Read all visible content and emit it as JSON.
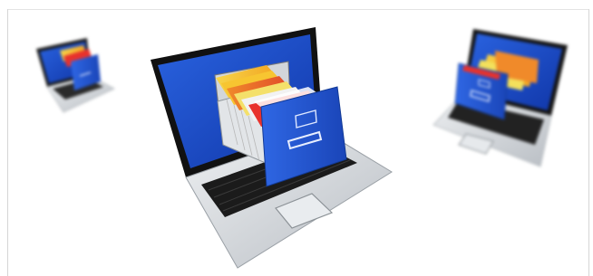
{
  "image": {
    "title_text_partial": "",
    "accent_colors": {
      "screen_blue": "#1f4fc9",
      "drawer_blue": "#2559d6",
      "laptop_silver": "#d9dde1",
      "title_blue": "#2c6aa8"
    },
    "objects": [
      "laptop-main",
      "laptop-left-small",
      "laptop-right-small"
    ]
  }
}
